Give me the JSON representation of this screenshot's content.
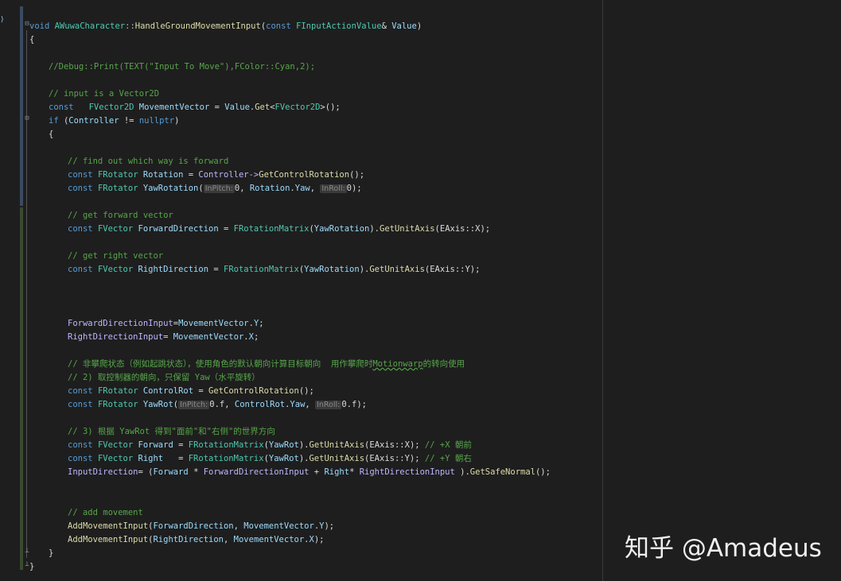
{
  "watermark": "知乎 @Amadeus",
  "code": {
    "l1": {
      "void": "void ",
      "cls": "AWuwaCharacter",
      "sep": "::",
      "fn": "HandleGroundMovementInput",
      "p1": "(",
      "const": "const ",
      "ty": "FInputActionValue",
      "amp": "& ",
      "var": "Value",
      "p2": ")"
    },
    "l2": "{",
    "l3": "//Debug::Print(TEXT(\"Input To Move\"),FColor::Cyan,2);",
    "l4": "// input is a Vector2D",
    "l5": {
      "const": "const   ",
      "ty": "FVector2D ",
      "var": "MovementVector",
      "eq": " = ",
      "val": "Value",
      "dot": ".",
      "fn": "Get",
      "lt": "<",
      "ty2": "FVector2D",
      "end": ">();"
    },
    "l6": {
      "kw": "if ",
      "p1": "(",
      "var": "Controller",
      "ne": " != ",
      "nul": "nullptr",
      "p2": ")"
    },
    "l7": "{",
    "l8": "// find out which way is forward",
    "l9": {
      "const": "const ",
      "ty": "FRotator ",
      "var": "Rotation",
      "eq": " = ",
      "ctl": "Controller",
      "arrow": "->",
      "fn": "GetControlRotation",
      "end": "();"
    },
    "l10": {
      "const": "const ",
      "ty": "FRotator ",
      "fn": "YawRotation",
      "p1": "(",
      "h1": "InPitch:",
      "a1": "0, ",
      "rot": "Rotation",
      "dot": ".",
      "yaw": "Yaw",
      "comma": ", ",
      "h2": "InRoll:",
      "a2": "0",
      "end": ");"
    },
    "l11": "// get forward vector",
    "l12": {
      "const": "const ",
      "ty": "FVector ",
      "var": "ForwardDirection",
      "eq": " = ",
      "rm": "FRotationMatrix",
      "p1": "(",
      "arg": "YawRotation",
      "p2": ").",
      "fn": "GetUnitAxis",
      "rest": "(EAxis::X);"
    },
    "l13": "// get right vector",
    "l14": {
      "const": "const ",
      "ty": "FVector ",
      "var": "RightDirection",
      "eq": " = ",
      "rm": "FRotationMatrix",
      "p1": "(",
      "arg": "YawRotation",
      "p2": ").",
      "fn": "GetUnitAxis",
      "rest": "(EAxis::Y);"
    },
    "l15": {
      "a": "ForwardDirectionInput",
      "eq": "=",
      "b": "MovementVector",
      "dot": ".",
      "c": "Y",
      "end": ";"
    },
    "l16": {
      "a": "RightDirectionInput",
      "eq": "= ",
      "b": "MovementVector",
      "dot": ".",
      "c": "X",
      "end": ";"
    },
    "l17": {
      "pre": "// 非攀爬状态（例如起跳状态），使用角色的默认朝向计算目标朝向  用作攀爬时",
      "sq": "Motionwarp",
      "post": "的转向使用"
    },
    "l18": "// 2) 取控制器的朝向，只保留 Yaw（水平旋转）",
    "l19": {
      "const": "const ",
      "ty": "FRotator ",
      "var": "ControlRot",
      "eq": " = ",
      "fn": "GetControlRotation",
      "end": "();"
    },
    "l20": {
      "const": "const ",
      "ty": "FRotator ",
      "fn": "YawRot",
      "p1": "(",
      "h1": "InPitch:",
      "a1": "0.f, ",
      "rot": "ControlRot",
      "dot": ".",
      "yaw": "Yaw",
      "comma": ", ",
      "h2": "InRoll:",
      "a2": "0.f",
      "end": ");"
    },
    "l21": "// 3) 根据 YawRot 得到\"面前\"和\"右侧\"的世界方向",
    "l22": {
      "const": "const ",
      "ty": "FVector ",
      "var": "Forward",
      "eq": " = ",
      "rm": "FRotationMatrix",
      "p1": "(",
      "arg": "YawRot",
      "p2": ").",
      "fn": "GetUnitAxis",
      "rest": "(EAxis::X); ",
      "cm": "// +X 朝前"
    },
    "l23": {
      "const": "const ",
      "ty": "FVector ",
      "var": "Right",
      "eq": "   = ",
      "rm": "FRotationMatrix",
      "p1": "(",
      "arg": "YawRot",
      "p2": ").",
      "fn": "GetUnitAxis",
      "rest": "(EAxis::Y); ",
      "cm": "// +Y 朝右"
    },
    "l24": {
      "a": "InputDirection",
      "eq": "= (",
      "b": "Forward",
      "m1": " * ",
      "c": "ForwardDirectionInput",
      "pl": " + ",
      "d": "Right",
      "m2": "* ",
      "e": "RightDirectionInput",
      "p": " ).",
      "fn": "GetSafeNormal",
      "end": "();"
    },
    "l25": "// add movement",
    "l26": {
      "fn": "AddMovementInput",
      "p1": "(",
      "a": "ForwardDirection",
      "c": ", ",
      "b": "MovementVector",
      "dot": ".",
      "y": "Y",
      "end": ");"
    },
    "l27": {
      "fn": "AddMovementInput",
      "p1": "(",
      "a": "RightDirection",
      "c": ", ",
      "b": "MovementVector",
      "dot": ".",
      "x": "X",
      "end": ");"
    },
    "l28": "}",
    "l29": "}"
  }
}
